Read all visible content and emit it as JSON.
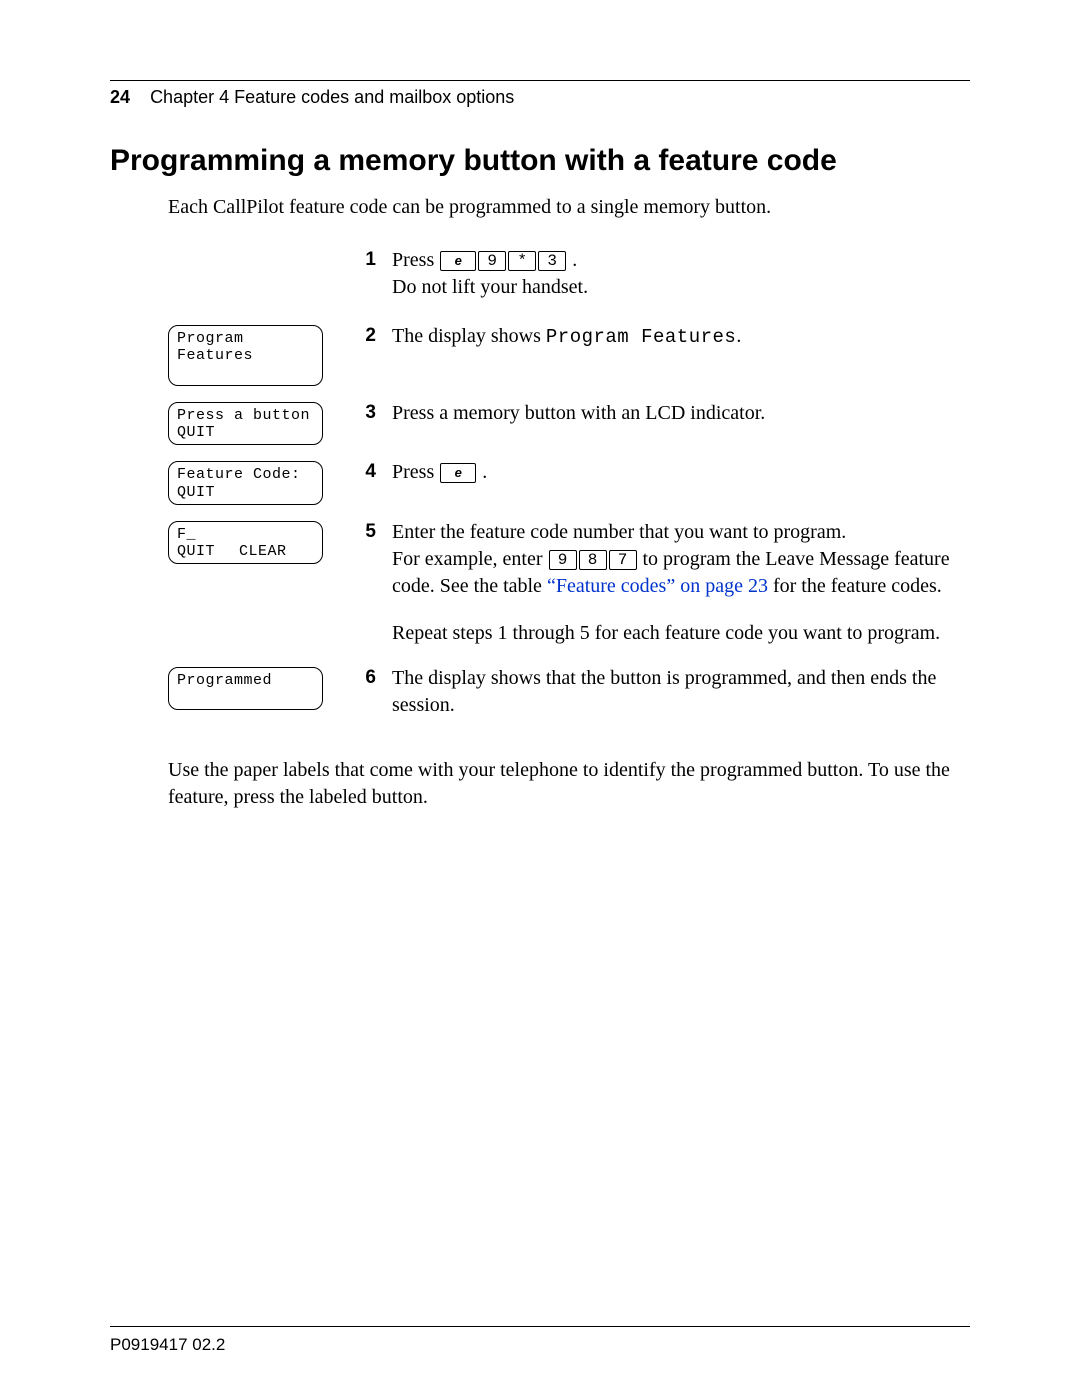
{
  "header": {
    "page_number": "24",
    "chapter_line": "Chapter 4  Feature codes and mailbox options"
  },
  "title": "Programming a memory button with a feature code",
  "intro": "Each CallPilot feature code can be programmed to a single memory button.",
  "steps": {
    "s1": {
      "num": "1",
      "pre": "Press ",
      "k1": "e",
      "k2": "9",
      "k3": "*",
      "k4": "3",
      "post": " .",
      "line2": "Do not lift your handset."
    },
    "s2": {
      "num": "2",
      "lcd_line1": "Program Features",
      "pre": "The display shows ",
      "mono": "Program Features",
      "post": "."
    },
    "s3": {
      "num": "3",
      "lcd_line1": "Press a button",
      "lcd_line2a": "QUIT",
      "text": "Press a memory button with an LCD indicator."
    },
    "s4": {
      "num": "4",
      "lcd_line1": "Feature Code:",
      "lcd_line2a": "QUIT",
      "pre": "Press ",
      "k1": "e",
      "post": " ."
    },
    "s5": {
      "num": "5",
      "lcd_line1": "F_",
      "lcd_line2a": "QUIT",
      "lcd_line2b": "CLEAR",
      "line1": "Enter the feature code number that you want to program.",
      "line2_pre": "For example, enter ",
      "k1": "9",
      "k2": "8",
      "k3": "7",
      "line2_post": "  to program the Leave Message feature code. See the table ",
      "link": "“Feature codes” on page 23",
      "line2_tail": " for the feature codes.",
      "para2": "Repeat steps 1 through 5 for each feature code you want to program."
    },
    "s6": {
      "num": "6",
      "lcd_line1": "Programmed",
      "text": "The display shows that the button is programmed, and then ends the session."
    }
  },
  "closing": "Use the paper labels that come with your telephone to identify the programmed button. To use the feature, press the labeled button.",
  "docid": "P0919417 02.2"
}
